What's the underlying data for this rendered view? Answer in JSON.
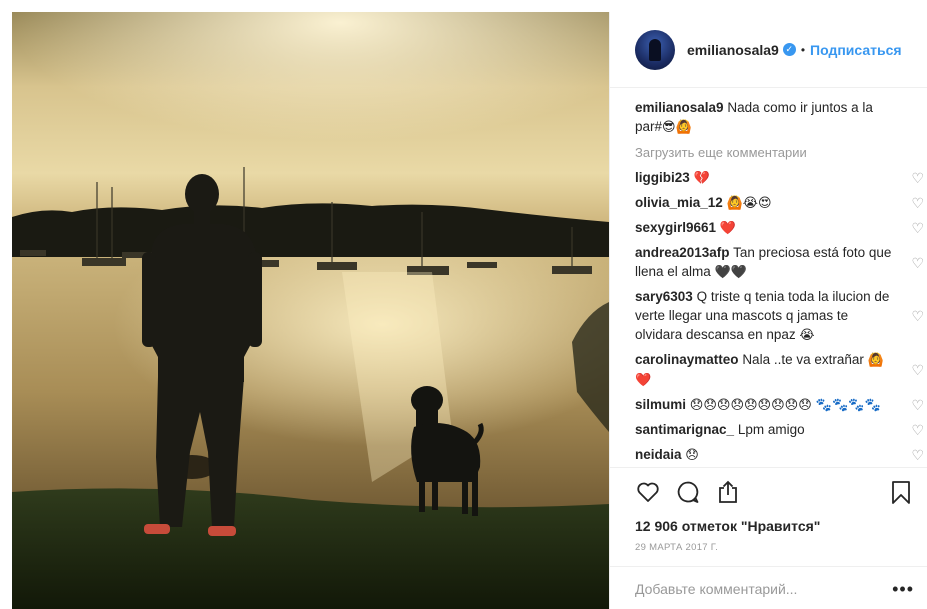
{
  "post": {
    "username": "emilianosala9",
    "verified_icon": "verified-badge-icon",
    "separator": "•",
    "follow_label": "Подписаться",
    "caption_user": "emilianosala9",
    "caption_text": "Nada como ir juntos a la par#",
    "caption_emoji": "😎🙆",
    "load_more": "Загрузить еще комментарии",
    "comments": [
      {
        "user": "liggibi23",
        "text": "",
        "emoji": "💔"
      },
      {
        "user": "olivia_mia_12",
        "text": "",
        "emoji": "🙆😭😍"
      },
      {
        "user": "sexygirl9661",
        "text": "",
        "emoji": "❤️"
      },
      {
        "user": "andrea2013afp",
        "text": "Tan preciosa está foto que llena el alma",
        "emoji": "🖤🖤"
      },
      {
        "user": "sary6303",
        "text": "Q triste q tenia toda la ilucion de verte llegar una mascots q jamas te olvidara descansa en npaz",
        "emoji": "😭"
      },
      {
        "user": "carolinaymatteo",
        "text": "Nala ..te va extrañar",
        "emoji": "🙆❤️"
      },
      {
        "user": "silmumi",
        "text": "",
        "emoji": "😞😞😞😞😞😞😞😞😞 🐾🐾🐾🐾"
      },
      {
        "user": "santimarignac_",
        "text": "Lpm amigo",
        "emoji": ""
      },
      {
        "user": "neidaia",
        "text": "",
        "emoji": "😞"
      }
    ],
    "likes": "12 906 отметок \"Нравится\"",
    "date": "29 марта 2017 г.",
    "add_comment_placeholder": "Добавьте комментарий...",
    "more_icon_glyph": "•••"
  },
  "icons": {
    "like": "heart-icon",
    "comment": "comment-icon",
    "share": "share-icon",
    "save": "bookmark-icon",
    "comment_like": "heart-outline-icon"
  },
  "colors": {
    "accent": "#3897f0",
    "heart_red": "#ed4956",
    "muted": "#999999",
    "text": "#262626"
  }
}
